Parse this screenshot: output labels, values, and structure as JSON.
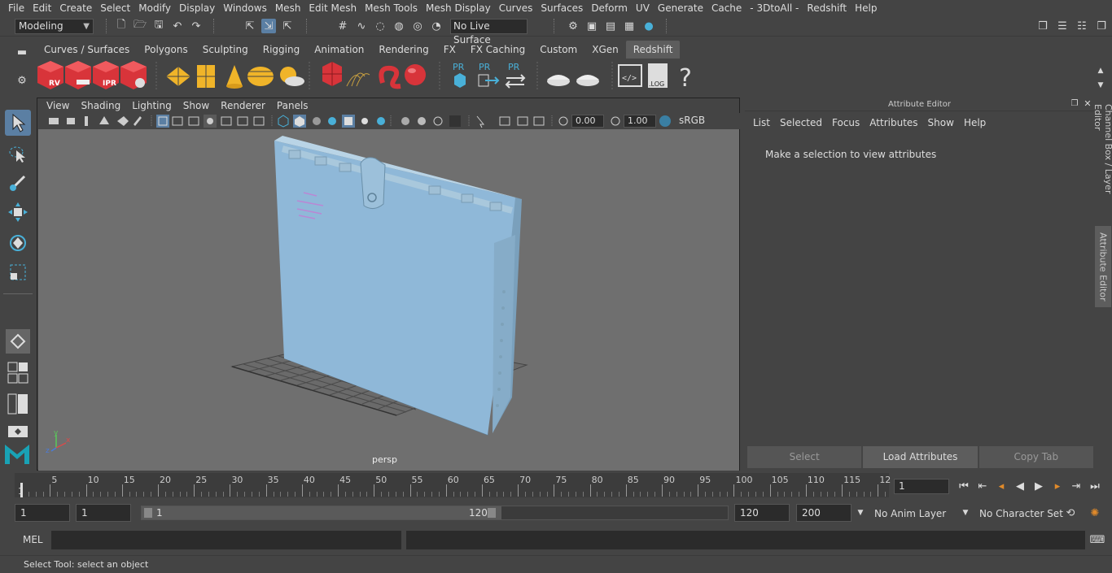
{
  "menubar": {
    "items": [
      "File",
      "Edit",
      "Create",
      "Select",
      "Modify",
      "Display",
      "Windows",
      "Mesh",
      "Edit Mesh",
      "Mesh Tools",
      "Mesh Display",
      "Curves",
      "Surfaces",
      "Deform",
      "UV",
      "Generate",
      "Cache",
      "- 3DtoAll -",
      "Redshift",
      "Help"
    ]
  },
  "statusline": {
    "mode": "Modeling",
    "live_surface": "No Live Surface"
  },
  "shelf": {
    "tabs": [
      "Curves / Surfaces",
      "Polygons",
      "Sculpting",
      "Rigging",
      "Animation",
      "Rendering",
      "FX",
      "FX Caching",
      "Custom",
      "XGen",
      "Redshift"
    ],
    "active_tab": "Redshift",
    "icons": {
      "rv": "RV",
      "ipr": "IPR",
      "pr": "PR",
      "log": ".LOG",
      "help": "?"
    }
  },
  "viewport": {
    "menu": [
      "View",
      "Shading",
      "Lighting",
      "Show",
      "Renderer",
      "Panels"
    ],
    "exposure": "0.00",
    "gamma": "1.00",
    "color_space": "sRGB gamma",
    "camera": "persp",
    "axis": {
      "x": "x",
      "y": "y",
      "z": "z"
    },
    "object_color": "#8fb8d8"
  },
  "attribute_editor": {
    "title": "Attribute Editor",
    "menu": [
      "List",
      "Selected",
      "Focus",
      "Attributes",
      "Show",
      "Help"
    ],
    "message": "Make a selection to view attributes",
    "buttons": [
      "Select",
      "Load Attributes",
      "Copy Tab"
    ]
  },
  "side_tabs": [
    "Channel Box / Layer Editor",
    "Attribute Editor"
  ],
  "timeline": {
    "labels": [
      "5",
      "10",
      "15",
      "20",
      "25",
      "30",
      "35",
      "40",
      "45",
      "50",
      "55",
      "60",
      "65",
      "70",
      "75",
      "80",
      "85",
      "90",
      "95",
      "100",
      "105",
      "110",
      "115",
      "12"
    ],
    "start_label": "1",
    "current_frame": "1"
  },
  "range": {
    "start": "1",
    "playback_start": "1",
    "slider_start": "1",
    "slider_end": "120",
    "playback_end": "120",
    "end": "200",
    "anim_layer": "No Anim Layer",
    "character_set": "No Character Set"
  },
  "command": {
    "language": "MEL"
  },
  "help": {
    "text": "Select Tool: select an object"
  }
}
